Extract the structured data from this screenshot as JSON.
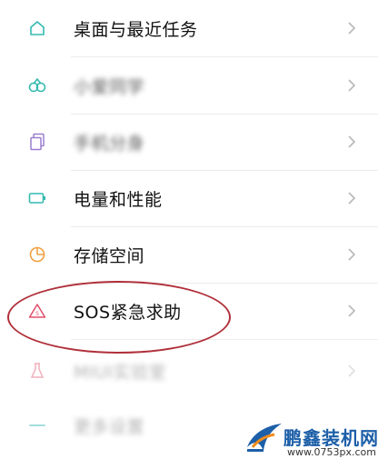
{
  "settings_list": {
    "items": [
      {
        "label": "桌面与最近任务",
        "icon": "home-icon"
      },
      {
        "label": "小爱同学",
        "icon": "xiaoai-icon"
      },
      {
        "label": "手机分身",
        "icon": "dual-phone-icon"
      },
      {
        "label": "电量和性能",
        "icon": "battery-icon"
      },
      {
        "label": "存储空间",
        "icon": "pie-chart-icon"
      },
      {
        "label": "SOS紧急求助",
        "icon": "sos-triangle-icon"
      },
      {
        "label": "MIUI实验室",
        "icon": "flask-icon"
      },
      {
        "label": "更多设置",
        "icon": "more-icon"
      }
    ]
  },
  "watermark": {
    "title": "鹏鑫装机网",
    "url": "www.0753px.com"
  },
  "colors": {
    "icon_teal": "#35b9b0",
    "icon_purple": "#9a7fd0",
    "icon_orange": "#f0a040",
    "icon_red": "#e0506a",
    "highlight": "#b0303a",
    "watermark_blue": "#1d5fa8"
  }
}
